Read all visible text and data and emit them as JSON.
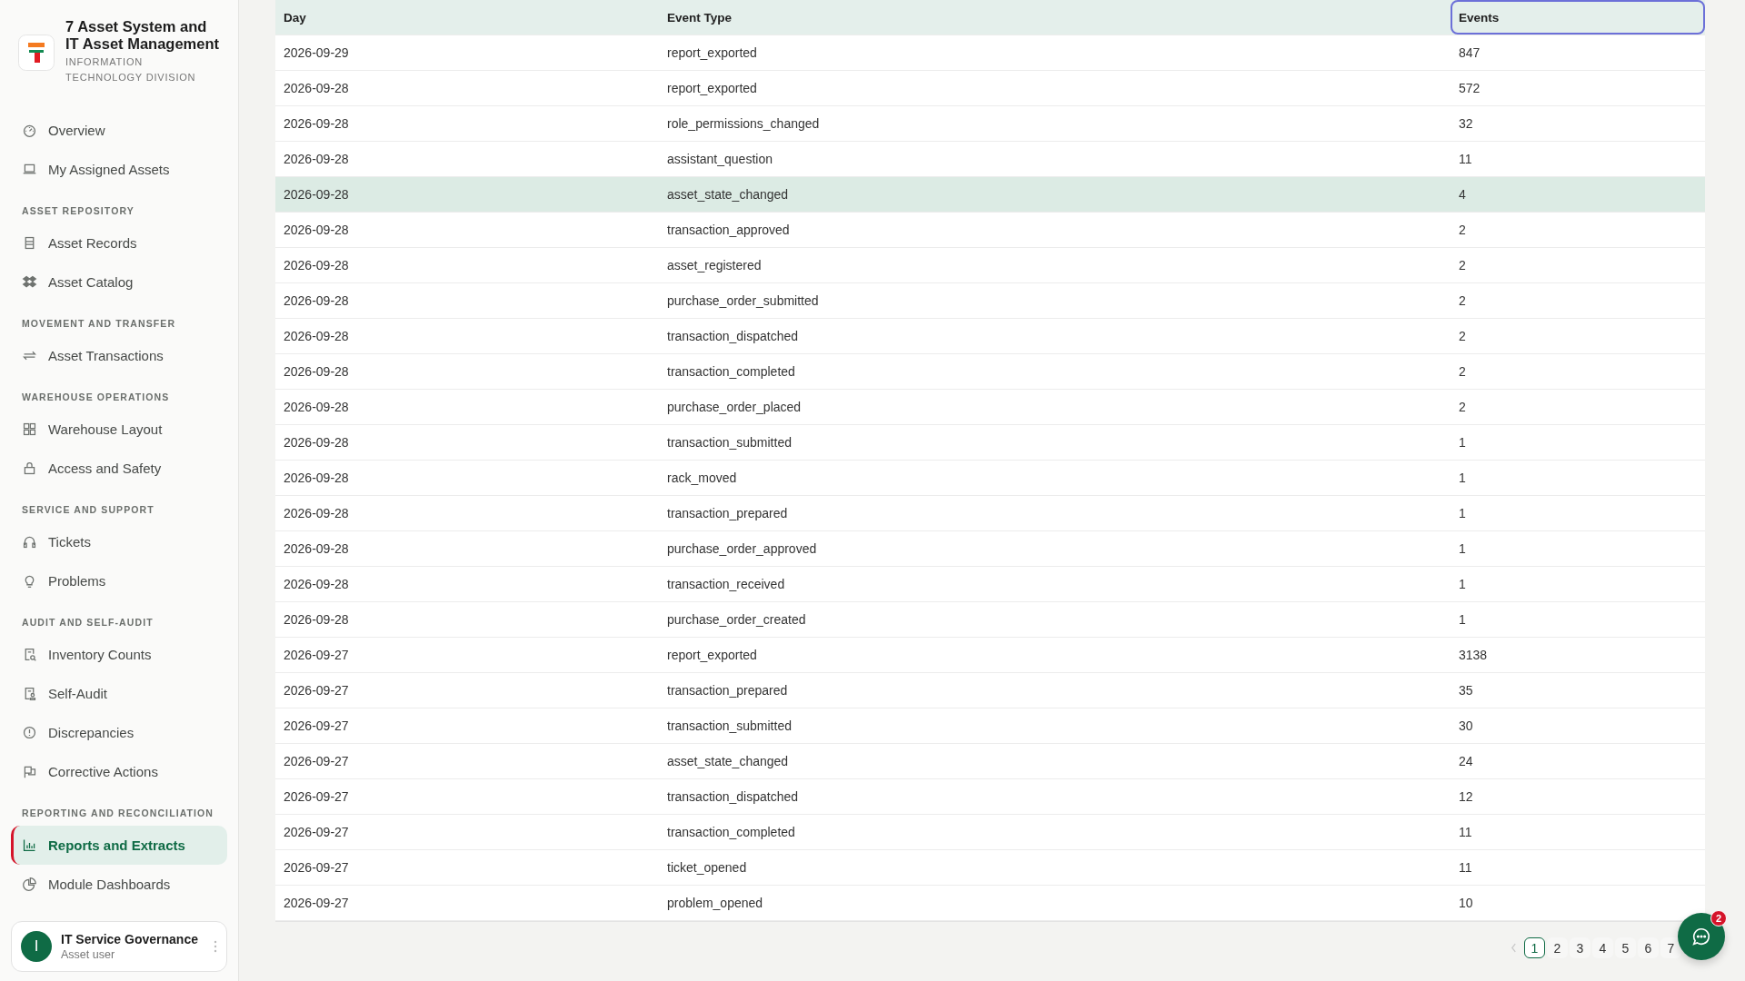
{
  "sidebar": {
    "app_title": "7 Asset System and IT Asset Management",
    "subtitle": "INFORMATION TECHNOLOGY DIVISION",
    "sections": [
      {
        "items": [
          {
            "label": "Overview",
            "selected": false
          },
          {
            "label": "My Assigned Assets",
            "selected": false
          }
        ]
      },
      {
        "heading": "ASSET REPOSITORY",
        "items": [
          {
            "label": "Asset Records",
            "selected": false
          },
          {
            "label": "Asset Catalog",
            "selected": false
          }
        ]
      },
      {
        "heading": "MOVEMENT AND TRANSFER",
        "items": [
          {
            "label": "Asset Transactions",
            "selected": false
          }
        ]
      },
      {
        "heading": "WAREHOUSE OPERATIONS",
        "items": [
          {
            "label": "Warehouse Layout",
            "selected": false
          },
          {
            "label": "Access and Safety",
            "selected": false
          }
        ]
      },
      {
        "heading": "SERVICE AND SUPPORT",
        "items": [
          {
            "label": "Tickets",
            "selected": false
          },
          {
            "label": "Problems",
            "selected": false
          }
        ]
      },
      {
        "heading": "AUDIT AND SELF-AUDIT",
        "items": [
          {
            "label": "Inventory Counts",
            "selected": false
          },
          {
            "label": "Self-Audit",
            "selected": false
          },
          {
            "label": "Discrepancies",
            "selected": false
          },
          {
            "label": "Corrective Actions",
            "selected": false
          }
        ]
      },
      {
        "heading": "REPORTING AND RECONCILIATION",
        "items": [
          {
            "label": "Reports and Extracts",
            "selected": true
          },
          {
            "label": "Module Dashboards",
            "selected": false
          }
        ]
      }
    ],
    "user": {
      "initial": "I",
      "name": "IT Service Governance",
      "role": "Asset user"
    }
  },
  "table": {
    "columns": [
      {
        "label": "Day",
        "focused": false
      },
      {
        "label": "Event Type",
        "focused": false
      },
      {
        "label": "Events",
        "focused": true
      }
    ],
    "rows": [
      {
        "cells": [
          "2026-09-29",
          "report_exported",
          "847"
        ],
        "hovered": false
      },
      {
        "cells": [
          "2026-09-28",
          "report_exported",
          "572"
        ],
        "hovered": false
      },
      {
        "cells": [
          "2026-09-28",
          "role_permissions_changed",
          "32"
        ],
        "hovered": false
      },
      {
        "cells": [
          "2026-09-28",
          "assistant_question",
          "11"
        ],
        "hovered": false
      },
      {
        "cells": [
          "2026-09-28",
          "asset_state_changed",
          "4"
        ],
        "hovered": true
      },
      {
        "cells": [
          "2026-09-28",
          "transaction_approved",
          "2"
        ],
        "hovered": false
      },
      {
        "cells": [
          "2026-09-28",
          "asset_registered",
          "2"
        ],
        "hovered": false
      },
      {
        "cells": [
          "2026-09-28",
          "purchase_order_submitted",
          "2"
        ],
        "hovered": false
      },
      {
        "cells": [
          "2026-09-28",
          "transaction_dispatched",
          "2"
        ],
        "hovered": false
      },
      {
        "cells": [
          "2026-09-28",
          "transaction_completed",
          "2"
        ],
        "hovered": false
      },
      {
        "cells": [
          "2026-09-28",
          "purchase_order_placed",
          "2"
        ],
        "hovered": false
      },
      {
        "cells": [
          "2026-09-28",
          "transaction_submitted",
          "1"
        ],
        "hovered": false
      },
      {
        "cells": [
          "2026-09-28",
          "rack_moved",
          "1"
        ],
        "hovered": false
      },
      {
        "cells": [
          "2026-09-28",
          "transaction_prepared",
          "1"
        ],
        "hovered": false
      },
      {
        "cells": [
          "2026-09-28",
          "purchase_order_approved",
          "1"
        ],
        "hovered": false
      },
      {
        "cells": [
          "2026-09-28",
          "transaction_received",
          "1"
        ],
        "hovered": false
      },
      {
        "cells": [
          "2026-09-28",
          "purchase_order_created",
          "1"
        ],
        "hovered": false
      },
      {
        "cells": [
          "2026-09-27",
          "report_exported",
          "3138"
        ],
        "hovered": false
      },
      {
        "cells": [
          "2026-09-27",
          "transaction_prepared",
          "35"
        ],
        "hovered": false
      },
      {
        "cells": [
          "2026-09-27",
          "transaction_submitted",
          "30"
        ],
        "hovered": false
      },
      {
        "cells": [
          "2026-09-27",
          "asset_state_changed",
          "24"
        ],
        "hovered": false
      },
      {
        "cells": [
          "2026-09-27",
          "transaction_dispatched",
          "12"
        ],
        "hovered": false
      },
      {
        "cells": [
          "2026-09-27",
          "transaction_completed",
          "11"
        ],
        "hovered": false
      },
      {
        "cells": [
          "2026-09-27",
          "ticket_opened",
          "11"
        ],
        "hovered": false
      },
      {
        "cells": [
          "2026-09-27",
          "problem_opened",
          "10"
        ],
        "hovered": false
      }
    ]
  },
  "pagination": {
    "pages": [
      {
        "label": "1",
        "selected": true
      },
      {
        "label": "2",
        "selected": false
      },
      {
        "label": "3",
        "selected": false
      },
      {
        "label": "4",
        "selected": false
      },
      {
        "label": "5",
        "selected": false
      },
      {
        "label": "6",
        "selected": false
      },
      {
        "label": "7",
        "selected": false
      }
    ]
  },
  "chat_button": {
    "badge": "2"
  }
}
